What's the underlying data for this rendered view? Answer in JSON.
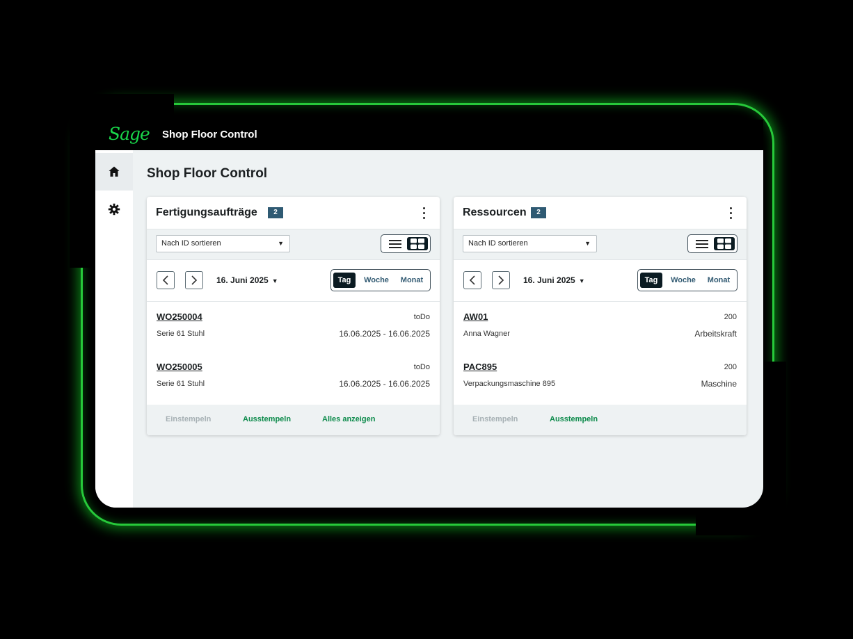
{
  "app": {
    "logo": "Sage",
    "header_title": "Shop Floor Control",
    "brand_color": "#19d64a"
  },
  "sidebar": {
    "items": [
      {
        "icon": "home-icon",
        "active": true
      },
      {
        "icon": "gear-icon",
        "active": false
      }
    ]
  },
  "page": {
    "title": "Shop Floor Control"
  },
  "cards": [
    {
      "title": "Fertigungsaufträge",
      "count": "2",
      "sort_label": "Nach ID sortieren",
      "date_label": "16. Juni 2025",
      "periods": [
        "Tag",
        "Woche",
        "Monat"
      ],
      "active_period": "Tag",
      "rows": [
        {
          "id": "WO250004",
          "sub": "Serie 61 Stuhl",
          "right1": "toDo",
          "right2": "16.06.2025 - 16.06.2025"
        },
        {
          "id": "WO250005",
          "sub": "Serie 61 Stuhl",
          "right1": "toDo",
          "right2": "16.06.2025 - 16.06.2025"
        }
      ],
      "footer": {
        "clock_in": "Einstempeln",
        "clock_out": "Ausstempeln",
        "show_all": "Alles anzeigen"
      }
    },
    {
      "title": "Ressourcen",
      "count": "2",
      "sort_label": "Nach ID sortieren",
      "date_label": "16. Juni 2025",
      "periods": [
        "Tag",
        "Woche",
        "Monat"
      ],
      "active_period": "Tag",
      "rows": [
        {
          "id": "AW01",
          "sub": "Anna Wagner",
          "right1": "200",
          "right2": "Arbeitskraft"
        },
        {
          "id": "PAC895",
          "sub": "Verpackungsmaschine 895",
          "right1": "200",
          "right2": "Maschine"
        }
      ],
      "footer": {
        "clock_in": "Einstempeln",
        "clock_out": "Ausstempeln"
      }
    }
  ]
}
